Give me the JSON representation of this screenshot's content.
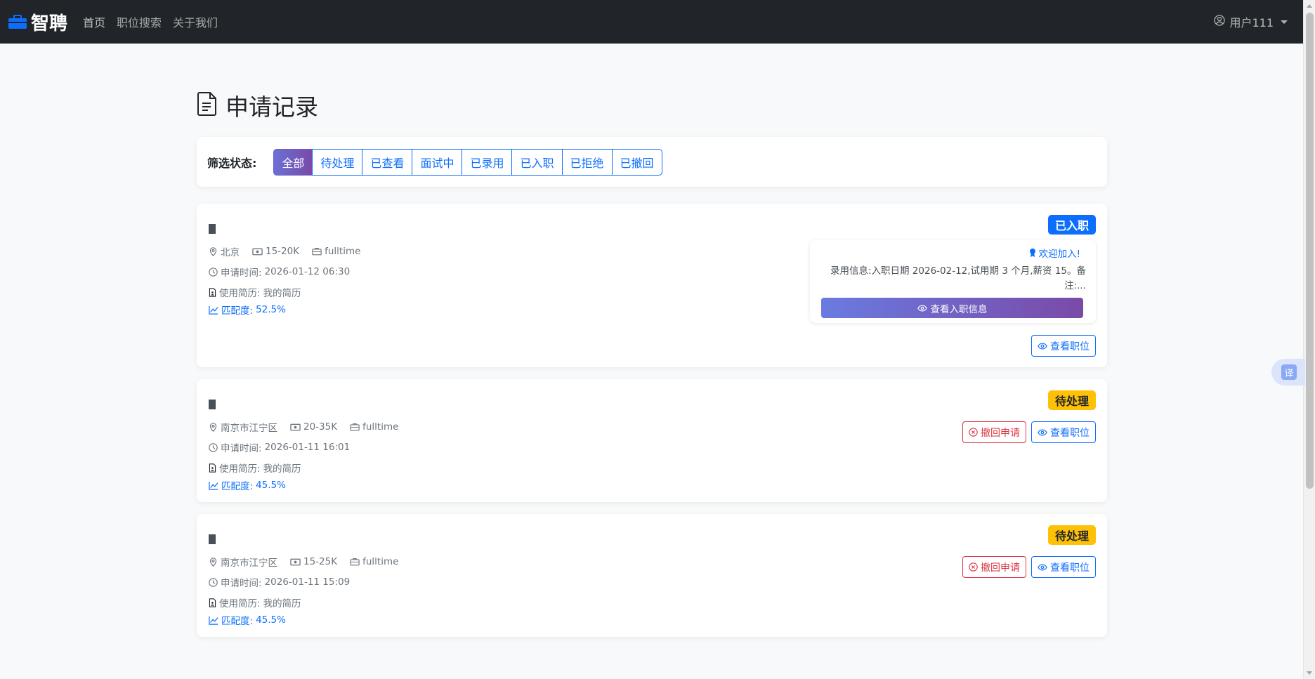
{
  "navbar": {
    "brand": "智聘",
    "links": [
      "首页",
      "职位搜索",
      "关于我们"
    ],
    "user": "用户111"
  },
  "translate": {
    "label": "译"
  },
  "page": {
    "title": "申请记录"
  },
  "filter": {
    "label": "筛选状态:",
    "options": [
      "全部",
      "待处理",
      "已查看",
      "面试中",
      "已录用",
      "已入职",
      "已拒绝",
      "已撤回"
    ],
    "active": "全部"
  },
  "applications": [
    {
      "location": "北京",
      "salary": "15-20K",
      "type": "fulltime",
      "applied_label": "申请时间:",
      "applied_time": "2026-01-12 06:30",
      "resume_label": "使用简历:",
      "resume": "我的简历",
      "match_label": "匹配度:",
      "match": "52.5%",
      "status": "已入职",
      "offer": {
        "welcome": "欢迎加入!",
        "info": "录用信息:入职日期 2026-02-12,试用期 3 个月,薪资 15。备注:...",
        "button": "查看入职信息"
      },
      "view_button": "查看职位"
    },
    {
      "location": "南京市江宁区",
      "salary": "20-35K",
      "type": "fulltime",
      "applied_label": "申请时间:",
      "applied_time": "2026-01-11 16:01",
      "resume_label": "使用简历:",
      "resume": "我的简历",
      "match_label": "匹配度:",
      "match": "45.5%",
      "status": "待处理",
      "withdraw_button": "撤回申请",
      "view_button": "查看职位"
    },
    {
      "location": "南京市江宁区",
      "salary": "15-25K",
      "type": "fulltime",
      "applied_label": "申请时间:",
      "applied_time": "2026-01-11 15:09",
      "resume_label": "使用简历:",
      "resume": "我的简历",
      "match_label": "匹配度:",
      "match": "45.5%",
      "status": "待处理",
      "withdraw_button": "撤回申请",
      "view_button": "查看职位"
    }
  ]
}
